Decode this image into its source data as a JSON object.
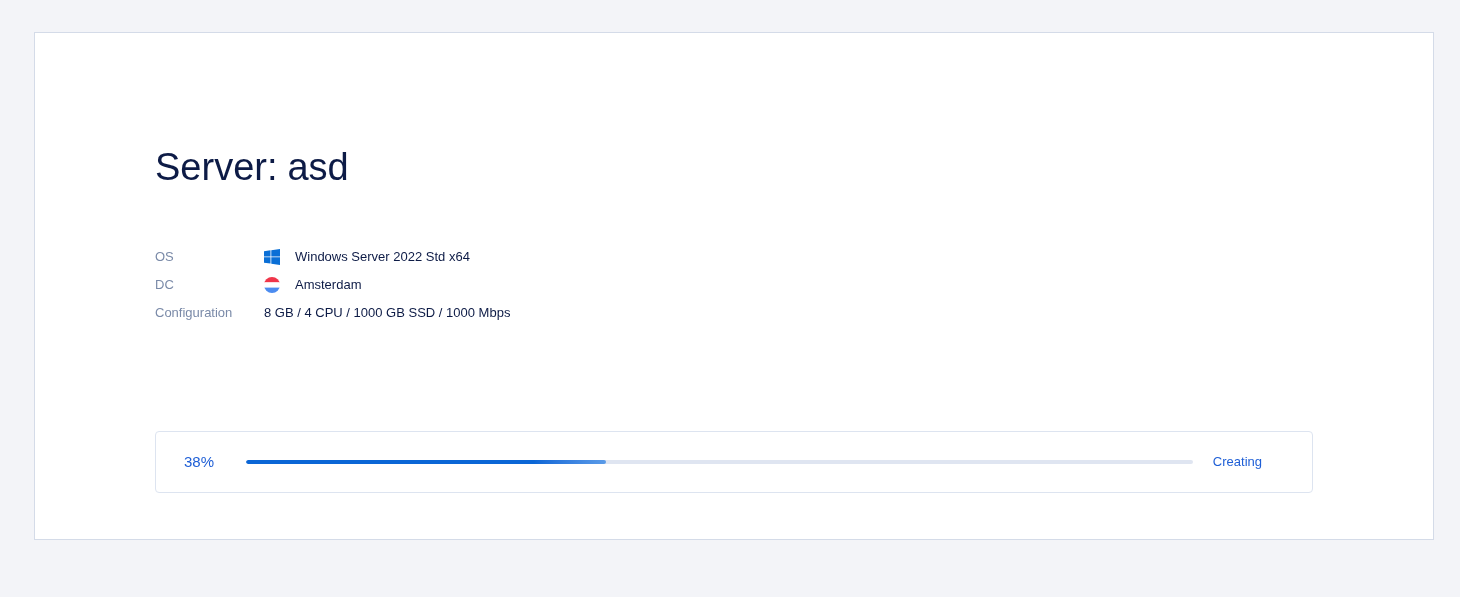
{
  "title": {
    "label": "Server:",
    "value": "asd"
  },
  "details": [
    {
      "label": "OS",
      "kind": "windows",
      "value": "Windows Server 2022 Std x64"
    },
    {
      "label": "DC",
      "kind": "flag",
      "value": "Amsterdam"
    },
    {
      "label": "Configuration",
      "kind": "plain",
      "value": "8 GB / 4 CPU / 1000 GB SSD / 1000 Mbps"
    }
  ],
  "progress": {
    "percent": "38%",
    "level": 0.38,
    "status": "Creating"
  }
}
